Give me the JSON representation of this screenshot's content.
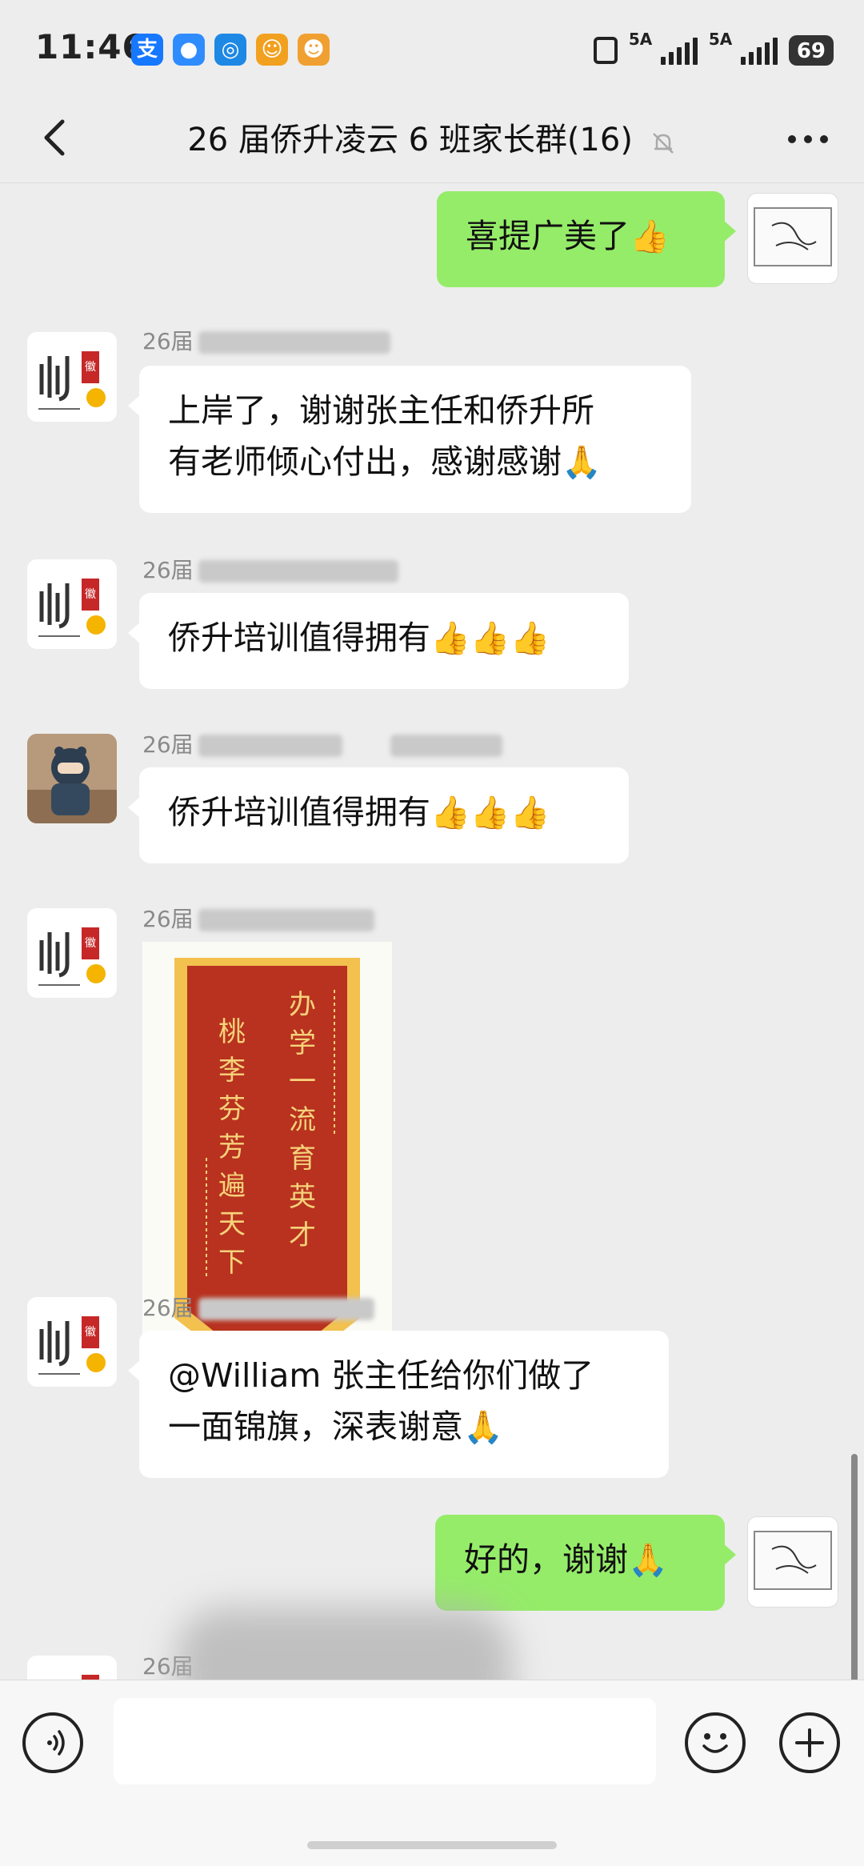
{
  "status_bar": {
    "time": "11:46",
    "apps": [
      {
        "icon": "alipay-icon",
        "glyph": "支",
        "color": "#1677ff"
      },
      {
        "icon": "chat-bubble-app-icon",
        "glyph": "●",
        "color": "#2f8cff"
      },
      {
        "icon": "lightbulb-app-icon",
        "glyph": "◎",
        "color": "#1e88e5"
      },
      {
        "icon": "face-app-icon",
        "glyph": "☺",
        "color": "#f2a020"
      },
      {
        "icon": "game-app-icon",
        "glyph": "☻",
        "color": "#f0a030"
      }
    ],
    "signal1_label": "5A",
    "signal2_label": "5A",
    "battery": "69"
  },
  "header": {
    "title": "26 届侨升凌云 6 班家长群(16)"
  },
  "messages": [
    {
      "side": "right",
      "text": "喜提广美了",
      "emoji": "👍"
    },
    {
      "side": "left",
      "name": "26届",
      "line1": "上岸了，谢谢张主任和侨升所",
      "line2": "有老师倾心付出，感谢感谢",
      "emoji": "🙏"
    },
    {
      "side": "left",
      "name": "26届",
      "text": "侨升培训值得拥有",
      "emoji": "👍👍👍"
    },
    {
      "side": "left",
      "name": "26届",
      "text": "侨升培训值得拥有",
      "emoji": "👍👍👍"
    },
    {
      "side": "left",
      "name": "26届",
      "banner": {
        "left": "桃李芬芳遍天下",
        "right": "办学一流育英才"
      }
    },
    {
      "side": "left",
      "name": "26届",
      "line1": "@William 张主任给你们做了",
      "line2": "一面锦旗，深表谢意",
      "emoji": "🙏"
    },
    {
      "side": "right",
      "text": "好的，谢谢",
      "emoji": "🙏"
    },
    {
      "side": "left",
      "name": "26届"
    }
  ],
  "avatar_logo": {
    "text": "卅",
    "seal": "徽商"
  },
  "colors": {
    "bubble_self": "#95ec69",
    "bubble_other": "#ffffff",
    "background": "#ededed",
    "banner_red": "#b8321f",
    "banner_gold": "#f2c14e"
  }
}
